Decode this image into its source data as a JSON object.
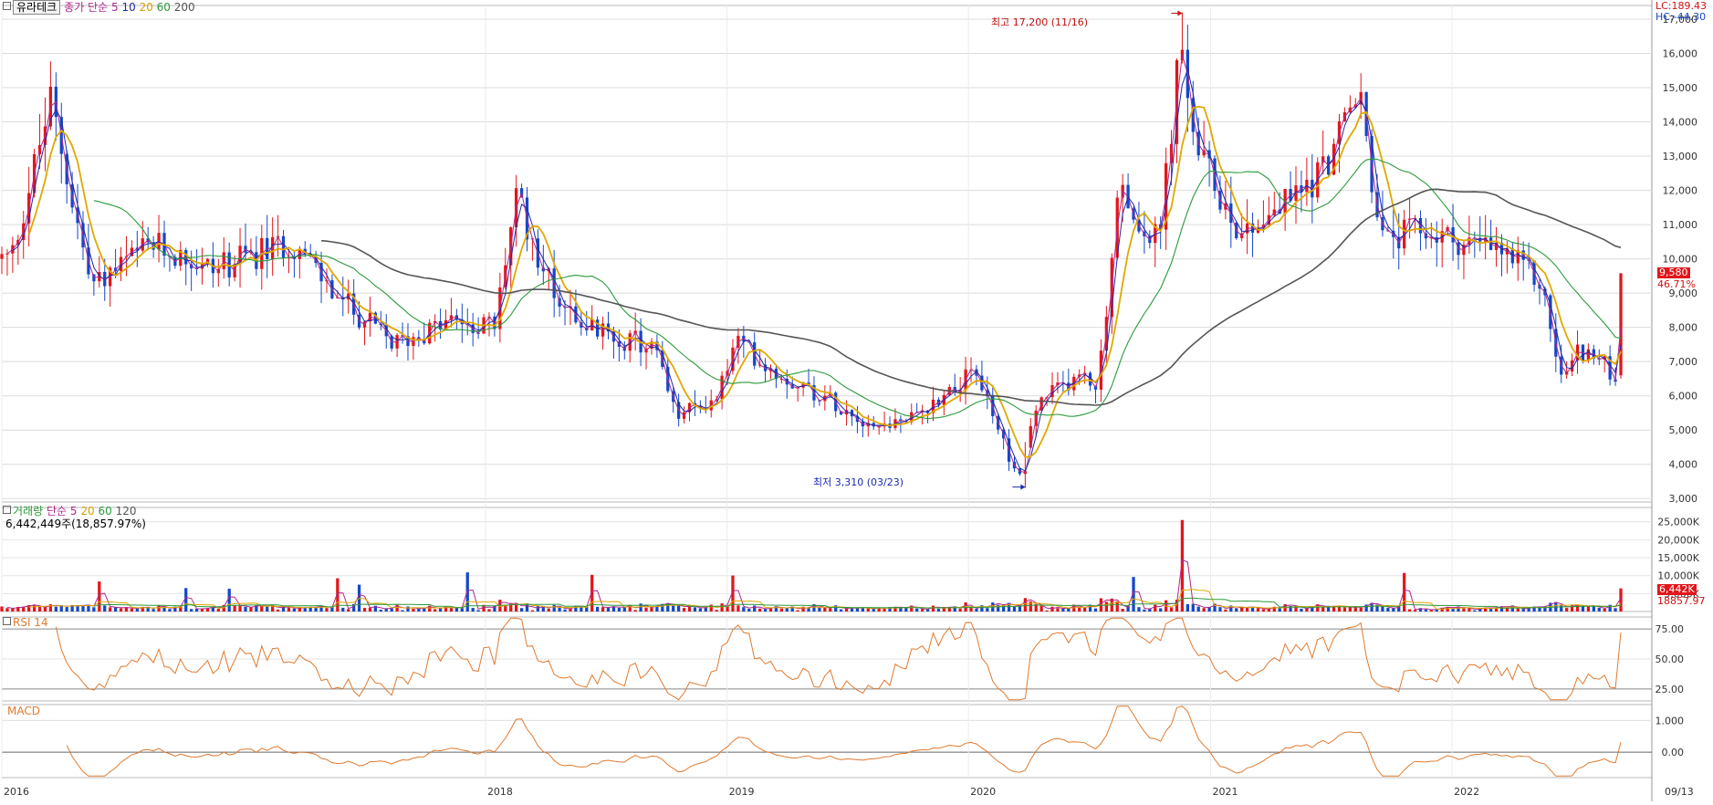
{
  "header": {
    "symbol": "유라테크",
    "price_ma": {
      "label": "종가 단순",
      "periods": [
        "5",
        "10",
        "20",
        "60",
        "200"
      ]
    },
    "lc": "LC:189.43",
    "hc": "HC:-44.30"
  },
  "price_panel": {
    "high_annotation": "최고 17,200 (11/16)",
    "low_annotation": "최저 3,310 (03/23)",
    "y_ticks": [
      "3,000",
      "4,000",
      "5,000",
      "6,000",
      "7,000",
      "8,000",
      "9,000",
      "10,000",
      "11,000",
      "12,000",
      "13,000",
      "14,000",
      "15,000",
      "16,000",
      "17,000"
    ],
    "last_price_tag": "9,580",
    "change_tag": "46.71%"
  },
  "volume_panel": {
    "legend_label": "거래량",
    "legend_ma_label": "단순",
    "periods": [
      "5",
      "20",
      "60",
      "120"
    ],
    "info": "6,442,449주(18,857.97%)",
    "y_ticks": [
      "5,000K",
      "10,000K",
      "15,000K",
      "20,000K",
      "25,000K"
    ],
    "last_volume_tag": "6,442K",
    "ratio_tag": "18857.97"
  },
  "rsi_panel": {
    "label": "RSI 14",
    "y_ticks": [
      "25.00",
      "50.00",
      "75.00"
    ]
  },
  "macd_panel": {
    "label": "MACD",
    "y_ticks": [
      "0.00",
      "1.000"
    ]
  },
  "x_axis": {
    "labels": [
      "2016",
      "2018",
      "2019",
      "2020",
      "2021",
      "2022",
      "09/13"
    ]
  },
  "colors": {
    "up": "#e3151a",
    "down": "#1448c8",
    "ma5": "#b0288e",
    "ma10": "#1e2aa8",
    "ma20": "#e0a800",
    "ma60": "#2b9a3a",
    "ma200": "#555555",
    "rsi": "#e07a2e",
    "macd": "#e07a2e"
  },
  "chart_data": {
    "type": "candlestick",
    "price_anchors": [
      {
        "date": "2016-01",
        "close": 10000
      },
      {
        "date": "2016-03",
        "close": 14600
      },
      {
        "date": "2016-05",
        "close": 9200
      },
      {
        "date": "2016-08",
        "close": 10400
      },
      {
        "date": "2016-11",
        "close": 9700
      },
      {
        "date": "2017-03",
        "close": 10500
      },
      {
        "date": "2017-05",
        "close": 9000
      },
      {
        "date": "2017-08",
        "close": 7500
      },
      {
        "date": "2017-11",
        "close": 8200
      },
      {
        "date": "2018-01",
        "close": 8000
      },
      {
        "date": "2018-02",
        "close": 11800
      },
      {
        "date": "2018-04",
        "close": 9000
      },
      {
        "date": "2018-06",
        "close": 7900
      },
      {
        "date": "2018-09",
        "close": 7400
      },
      {
        "date": "2018-10",
        "close": 5400
      },
      {
        "date": "2018-12",
        "close": 5900
      },
      {
        "date": "2019-01",
        "close": 7600
      },
      {
        "date": "2019-03",
        "close": 6700
      },
      {
        "date": "2019-06",
        "close": 5800
      },
      {
        "date": "2019-08",
        "close": 5100
      },
      {
        "date": "2019-10",
        "close": 5400
      },
      {
        "date": "2019-12",
        "close": 6400
      },
      {
        "date": "2020-01",
        "close": 6600
      },
      {
        "date": "2020-03",
        "close": 3600
      },
      {
        "date": "2020-04",
        "close": 5800
      },
      {
        "date": "2020-06",
        "close": 6600
      },
      {
        "date": "2020-07",
        "close": 6300
      },
      {
        "date": "2020-08",
        "close": 12000
      },
      {
        "date": "2020-09",
        "close": 11000
      },
      {
        "date": "2020-10",
        "close": 10500
      },
      {
        "date": "2020-11",
        "close": 16000
      },
      {
        "date": "2020-12",
        "close": 13000
      },
      {
        "date": "2021-02",
        "close": 10800
      },
      {
        "date": "2021-04",
        "close": 11500
      },
      {
        "date": "2021-06",
        "close": 12500
      },
      {
        "date": "2021-08",
        "close": 14800
      },
      {
        "date": "2021-09",
        "close": 10500
      },
      {
        "date": "2021-11",
        "close": 10800
      },
      {
        "date": "2022-01",
        "close": 10500
      },
      {
        "date": "2022-03",
        "close": 10200
      },
      {
        "date": "2022-05",
        "close": 9300
      },
      {
        "date": "2022-06",
        "close": 6500
      },
      {
        "date": "2022-07",
        "close": 7400
      },
      {
        "date": "2022-09-12",
        "close": 6500
      },
      {
        "date": "2022-09-13",
        "close": 9580
      }
    ],
    "price_range": [
      2900,
      17400
    ],
    "volume_range": [
      0,
      29000
    ],
    "rsi_range": [
      15,
      85
    ],
    "macd_range": [
      -0.8,
      1.5
    ]
  }
}
